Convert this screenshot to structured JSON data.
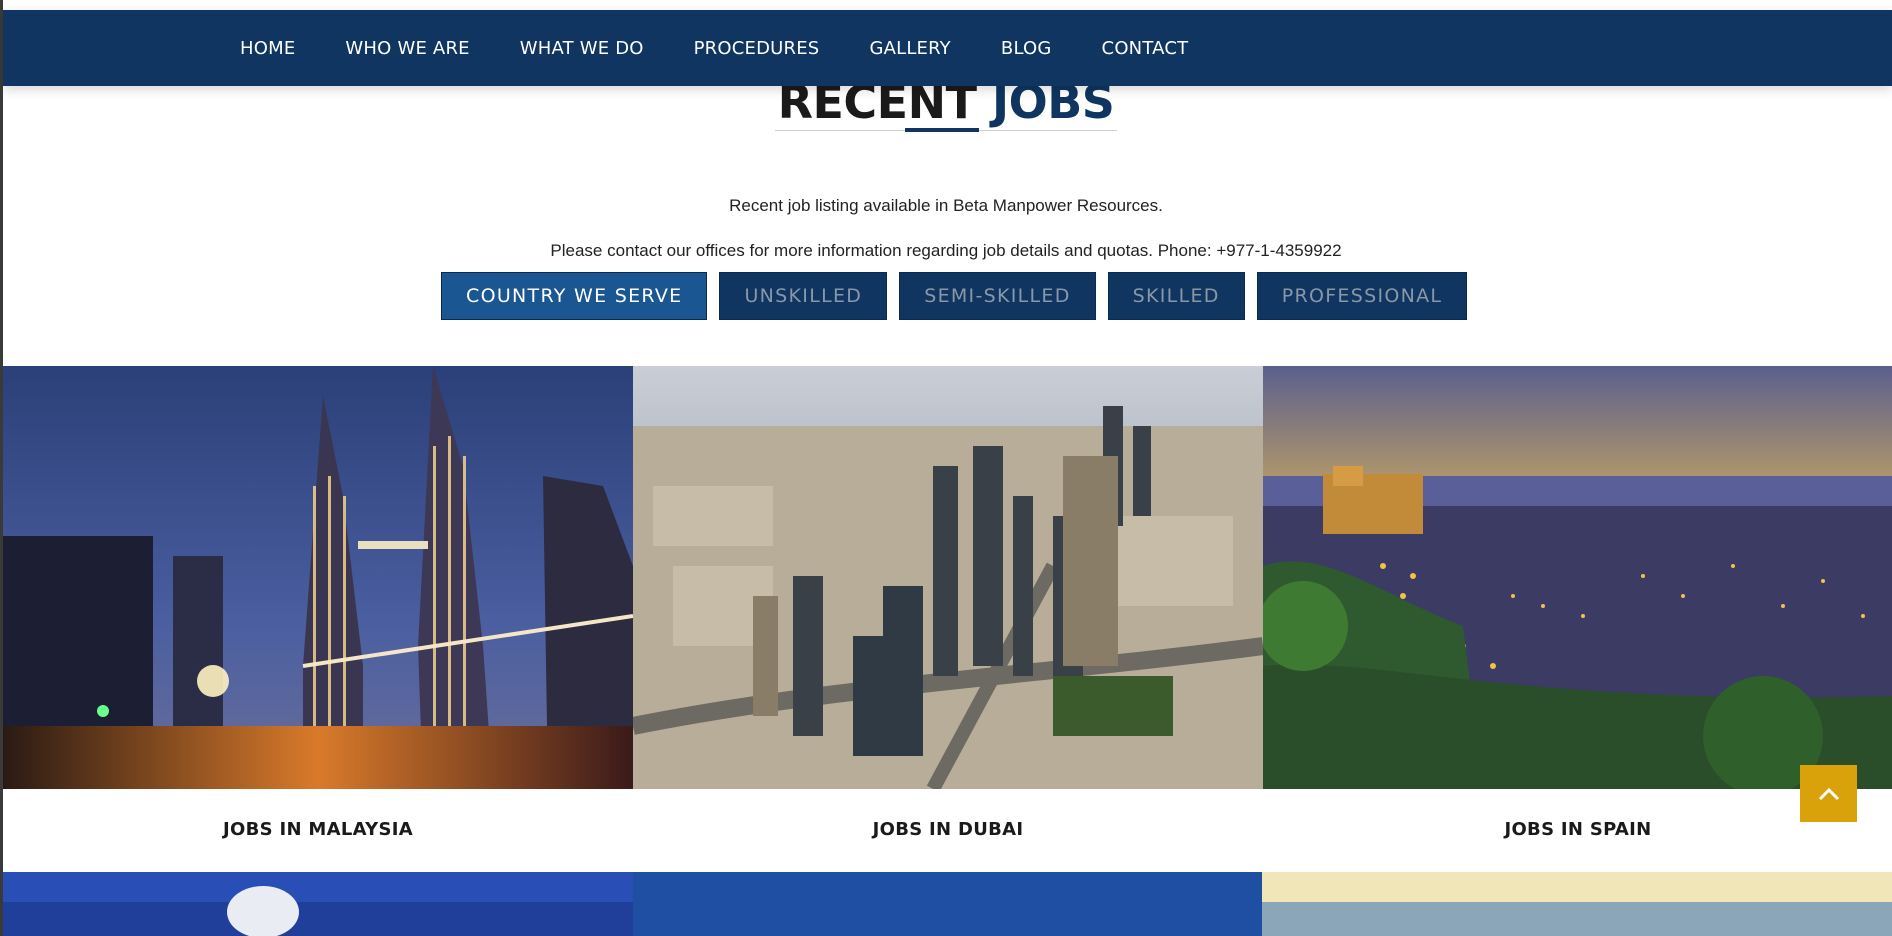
{
  "nav": {
    "items": [
      "HOME",
      "WHO WE ARE",
      "WHAT WE DO",
      "PROCEDURES",
      "GALLERY",
      "BLOG",
      "CONTACT"
    ]
  },
  "section": {
    "title_part1": "RECENT",
    "title_part2": "JOBS",
    "intro": "Recent job listing available in Beta Manpower Resources.",
    "contact_line": "Please contact our offices for more information regarding job details and quotas. Phone: +977-1-4359922"
  },
  "filters": {
    "items": [
      {
        "label": "COUNTRY WE SERVE",
        "active": true
      },
      {
        "label": "UNSKILLED",
        "active": false
      },
      {
        "label": "SEMI-SKILLED",
        "active": false
      },
      {
        "label": "SKILLED",
        "active": false
      },
      {
        "label": "PROFESSIONAL",
        "active": false
      }
    ]
  },
  "cards": [
    {
      "caption": "JOBS IN MALAYSIA",
      "image": "kuala-lumpur-petronas-towers-night"
    },
    {
      "caption": "JOBS IN DUBAI",
      "image": "dubai-skyline-aerial"
    },
    {
      "caption": "JOBS IN SPAIN",
      "image": "granada-alhambra-dusk"
    }
  ],
  "colors": {
    "nav_bg": "#0f3560",
    "active_filter": "#1a5792",
    "scroll_top": "#d9a20a"
  },
  "icons": {
    "scroll_top": "chevron-up-icon"
  }
}
